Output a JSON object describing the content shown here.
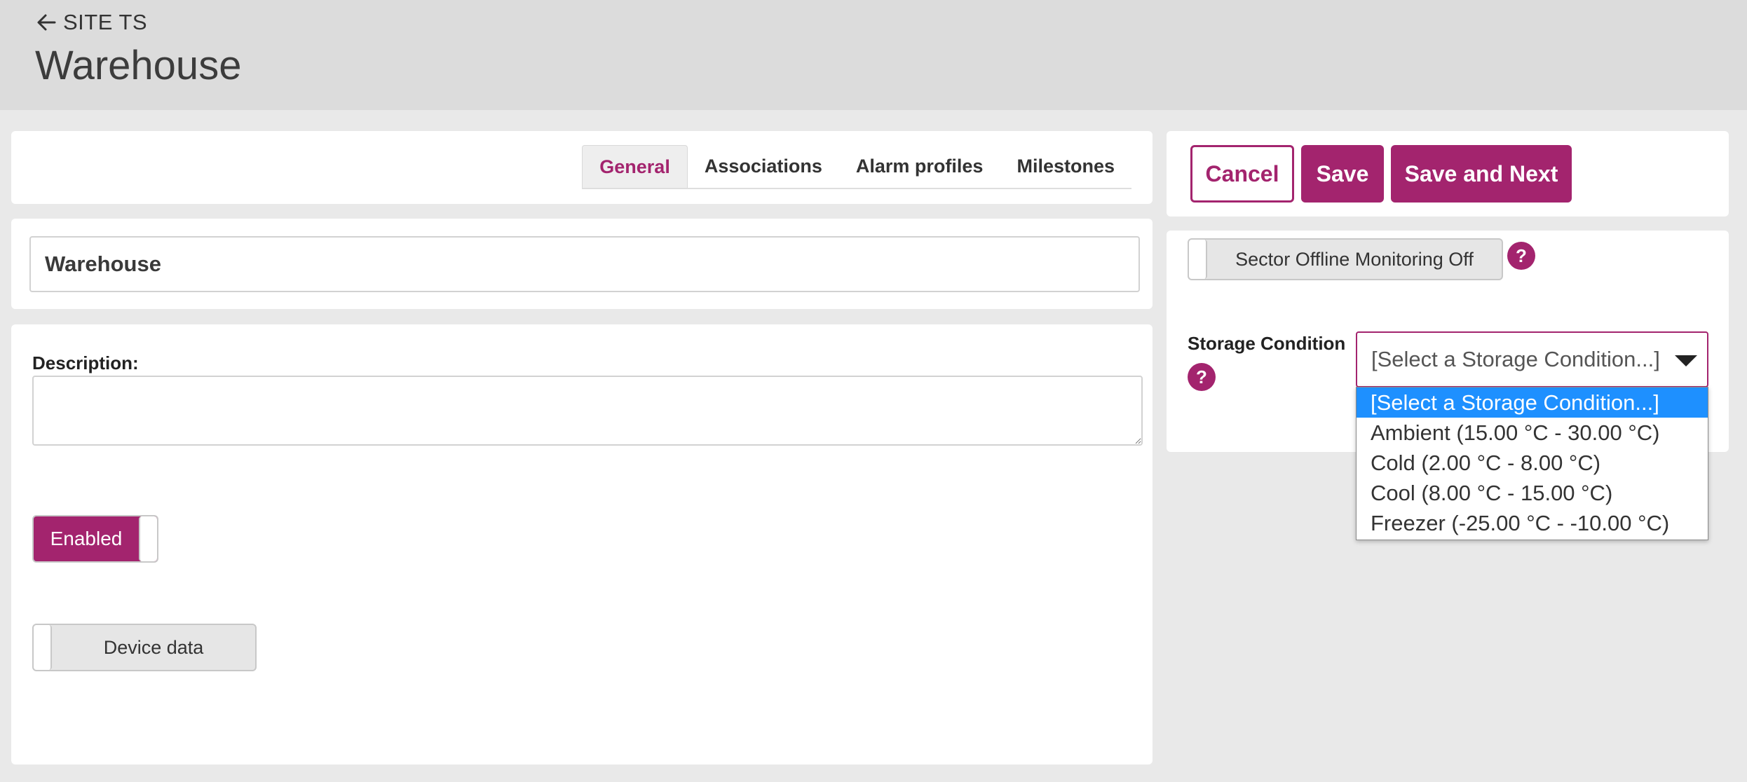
{
  "header": {
    "back_label": "SITE TS",
    "title": "Warehouse"
  },
  "tabs": [
    {
      "label": "General",
      "active": true
    },
    {
      "label": "Associations",
      "active": false
    },
    {
      "label": "Alarm profiles",
      "active": false
    },
    {
      "label": "Milestones",
      "active": false
    }
  ],
  "form": {
    "name_value": "Warehouse",
    "description_label": "Description:",
    "description_value": "",
    "enabled_label": "Enabled",
    "enabled": true,
    "device_data_label": "Device data",
    "device_data": false
  },
  "actions": {
    "cancel": "Cancel",
    "save": "Save",
    "save_next": "Save and Next"
  },
  "sector": {
    "toggle_label": "Sector Offline Monitoring Off",
    "enabled": false,
    "help": "?"
  },
  "storage": {
    "label": "Storage Condition",
    "help": "?",
    "selected": "[Select a Storage Condition...]",
    "options": [
      "[Select a Storage Condition...]",
      "Ambient (15.00 °C - 30.00 °C)",
      "Cold (2.00 °C - 8.00 °C)",
      "Cool (8.00 °C - 15.00 °C)",
      "Freezer (-25.00 °C - -10.00 °C)"
    ]
  },
  "colors": {
    "accent": "#a3246e",
    "header_bg": "#dcdcdc",
    "page_bg": "#e9e9e9",
    "option_highlight": "#1e90ff"
  }
}
